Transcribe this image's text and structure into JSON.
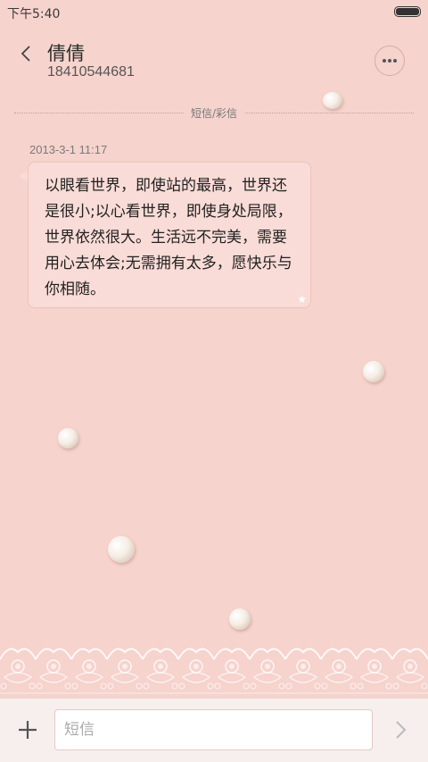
{
  "status_bar": {
    "time": "下午5:40"
  },
  "header": {
    "contact_name": "倩倩",
    "contact_number": "18410544681"
  },
  "thread": {
    "divider_label": "短信/彩信",
    "timestamp": "2013-3-1 11:17",
    "message": "以眼看世界，即使站的最高，世界还是很小;以心看世界，即使身处局限，世界依然很大。生活远不完美，需要用心去体会;无需拥有太多，愿快乐与你相随。"
  },
  "composer": {
    "placeholder": "短信"
  },
  "colors": {
    "background": "#f6d3cd",
    "bubble": "#f9dcd7",
    "input_bar": "#f7efee"
  }
}
